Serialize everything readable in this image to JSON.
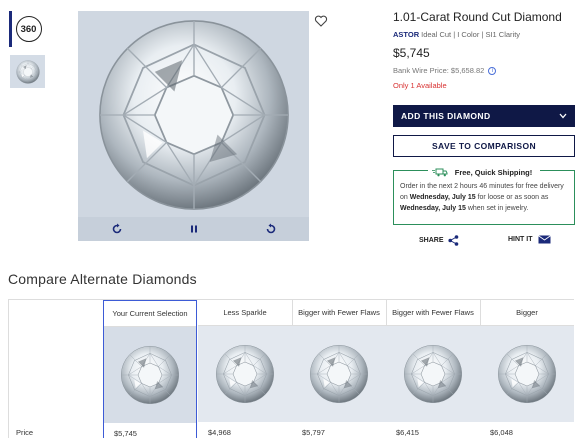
{
  "gallery": {
    "thumb_360_label": "360",
    "viewer_controls": [
      "rotate-left-icon",
      "pause-icon",
      "rotate-right-icon"
    ]
  },
  "product": {
    "title": "1.01-Carat Round Cut Diamond",
    "brand": "ASTOR",
    "specs": "Ideal Cut | I Color | SI1 Clarity",
    "price": "$5,745",
    "bank_wire_label": "Bank Wire Price: $5,658.82",
    "availability": "Only 1 Available",
    "availability_color": "#d83232"
  },
  "actions": {
    "add_label": "ADD THIS DIAMOND",
    "compare_label": "SAVE TO COMPARISON",
    "share_label": "SHARE",
    "hint_label": "HINT IT"
  },
  "shipping": {
    "title": "Free, Quick Shipping!",
    "line1": "Order in the next 2 hours 46 minutes for free delivery on",
    "date1": "Wednesday, July 15",
    "line2": "for loose or as soon as",
    "date2": "Wednesday, July 15",
    "line3": "when set in jewelry.",
    "accent": "#2c8f5b"
  },
  "compare": {
    "heading": "Compare Alternate Diamonds",
    "row_label_price": "Price",
    "columns": [
      {
        "label": "Your Current Selection",
        "price": "$5,745"
      },
      {
        "label": "Less Sparkle",
        "price": "$4,968"
      },
      {
        "label": "Bigger with Fewer Flaws",
        "price": "$5,797"
      },
      {
        "label": "Bigger with Fewer Flaws",
        "price": "$6,415"
      },
      {
        "label": "Bigger",
        "price": "$6,048"
      }
    ]
  },
  "colors": {
    "brand_navy": "#0f1846",
    "selection_blue": "#3d5bd6"
  }
}
